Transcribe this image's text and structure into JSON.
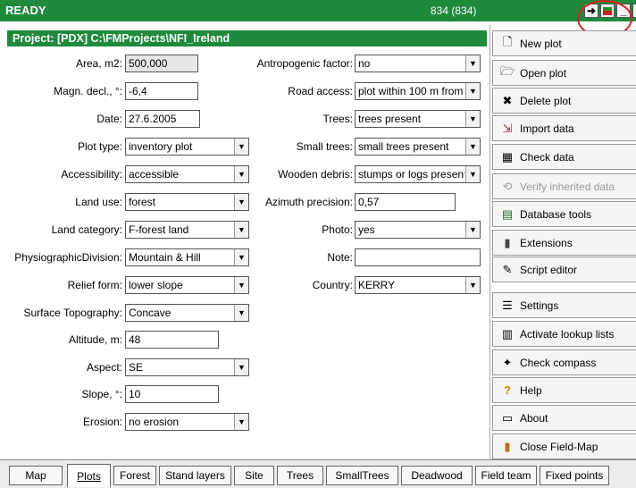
{
  "topbar": {
    "status": "READY",
    "count": "834 (834)"
  },
  "project": {
    "title": "Project:  [PDX] C:\\FMProjects\\NFI_Ireland"
  },
  "left_fields": [
    {
      "label": "Area, m2:",
      "value": "500,000",
      "kind": "readonly"
    },
    {
      "label": "Magn. decl., °:",
      "value": "-6,4",
      "kind": "text"
    },
    {
      "label": "Date:",
      "value": "27.6.2005",
      "kind": "text"
    },
    {
      "label": "Plot type:",
      "value": "inventory plot",
      "kind": "combo"
    },
    {
      "label": "Accessibility:",
      "value": "accessible",
      "kind": "combo"
    },
    {
      "label": "Land use:",
      "value": "forest",
      "kind": "combo"
    },
    {
      "label": "Land category:",
      "value": "F-forest land",
      "kind": "combo"
    },
    {
      "label": "PhysiographicDivision:",
      "value": "Mountain & Hill",
      "kind": "combo"
    },
    {
      "label": "Relief form:",
      "value": "lower slope",
      "kind": "combo"
    },
    {
      "label": "Surface Topography:",
      "value": "Concave",
      "kind": "combo"
    },
    {
      "label": "Altitude, m:",
      "value": "48",
      "kind": "text"
    },
    {
      "label": "Aspect:",
      "value": "SE",
      "kind": "combo"
    },
    {
      "label": "Slope, °:",
      "value": "10",
      "kind": "text"
    },
    {
      "label": "Erosion:",
      "value": "no erosion",
      "kind": "combo"
    }
  ],
  "right_fields": [
    {
      "label": "Antropogenic factor:",
      "value": "no",
      "kind": "combo"
    },
    {
      "label": "Road access:",
      "value": "plot within 100 m from",
      "kind": "combo"
    },
    {
      "label": "Trees:",
      "value": "trees present",
      "kind": "combo"
    },
    {
      "label": "Small trees:",
      "value": "small trees present",
      "kind": "combo"
    },
    {
      "label": "Wooden debris:",
      "value": "stumps or logs present",
      "kind": "combo"
    },
    {
      "label": "Azimuth precision:",
      "value": "0,57",
      "kind": "text"
    },
    {
      "label": "Photo:",
      "value": "yes",
      "kind": "combo"
    },
    {
      "label": "Note:",
      "value": "",
      "kind": "text"
    },
    {
      "label": "Country:",
      "value": "KERRY",
      "kind": "combo"
    }
  ],
  "sidebar": [
    {
      "label": "New plot",
      "icon": "new-plot-icon",
      "enabled": true
    },
    {
      "label": "Open plot",
      "icon": "open-plot-icon",
      "enabled": true
    },
    {
      "label": "Delete plot",
      "icon": "delete-plot-icon",
      "enabled": true
    },
    {
      "label": "Import data",
      "icon": "import-data-icon",
      "enabled": true
    },
    {
      "label": "Check data",
      "icon": "check-data-icon",
      "enabled": true
    },
    {
      "label": "Verify inherited data",
      "icon": "verify-icon",
      "enabled": false
    },
    {
      "label": "Database tools",
      "icon": "database-icon",
      "enabled": true
    },
    {
      "label": "Extensions",
      "icon": "extensions-icon",
      "enabled": true
    },
    {
      "label": "Script editor",
      "icon": "script-icon",
      "enabled": true
    },
    {
      "label": "Settings",
      "icon": "settings-icon",
      "enabled": true
    },
    {
      "label": "Activate lookup lists",
      "icon": "lookup-icon",
      "enabled": true
    },
    {
      "label": "Check compass",
      "icon": "compass-icon",
      "enabled": true
    },
    {
      "label": "Help",
      "icon": "help-icon",
      "enabled": true
    },
    {
      "label": "About",
      "icon": "about-icon",
      "enabled": true
    },
    {
      "label": "Close Field-Map",
      "icon": "close-icon",
      "enabled": true
    }
  ],
  "tabs": [
    "Map",
    "Plots",
    "Forest",
    "Stand layers",
    "Site",
    "Trees",
    "SmallTrees",
    "Deadwood",
    "Field team",
    "Fixed points"
  ],
  "active_tab": "Plots",
  "colors": {
    "title_bar": "#1f8a3c",
    "annotation": "#d22222"
  },
  "caret": "▼"
}
